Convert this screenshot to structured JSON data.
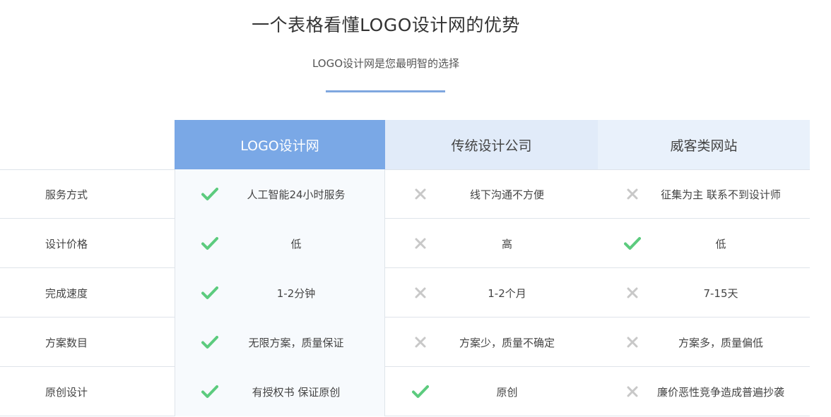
{
  "header": {
    "title": "一个表格看懂LOGO设计网的优势",
    "subtitle": "LOGO设计网是您最明智的选择"
  },
  "colors": {
    "accent": "#7aa8e6",
    "check": "#5ccb7e",
    "cross": "#c8c8c8"
  },
  "table": {
    "columns": [
      "LOGO设计网",
      "传统设计公司",
      "威客类网站"
    ],
    "rows": [
      {
        "label": "服务方式",
        "cells": [
          {
            "mark": "check",
            "text": "人工智能24小时服务"
          },
          {
            "mark": "cross",
            "text": "线下沟通不方便"
          },
          {
            "mark": "cross",
            "text": "征集为主 联系不到设计师"
          }
        ]
      },
      {
        "label": "设计价格",
        "cells": [
          {
            "mark": "check",
            "text": "低"
          },
          {
            "mark": "cross",
            "text": "高"
          },
          {
            "mark": "check",
            "text": "低"
          }
        ]
      },
      {
        "label": "完成速度",
        "cells": [
          {
            "mark": "check",
            "text": "1-2分钟"
          },
          {
            "mark": "cross",
            "text": "1-2个月"
          },
          {
            "mark": "cross",
            "text": "7-15天"
          }
        ]
      },
      {
        "label": "方案数目",
        "cells": [
          {
            "mark": "check",
            "text": "无限方案，质量保证"
          },
          {
            "mark": "cross",
            "text": "方案少，质量不确定"
          },
          {
            "mark": "cross",
            "text": "方案多，质量偏低"
          }
        ]
      },
      {
        "label": "原创设计",
        "cells": [
          {
            "mark": "check",
            "text": "有授权书 保证原创"
          },
          {
            "mark": "check",
            "text": "原创"
          },
          {
            "mark": "cross",
            "text": "廉价恶性竞争造成普遍抄袭"
          }
        ]
      }
    ]
  }
}
